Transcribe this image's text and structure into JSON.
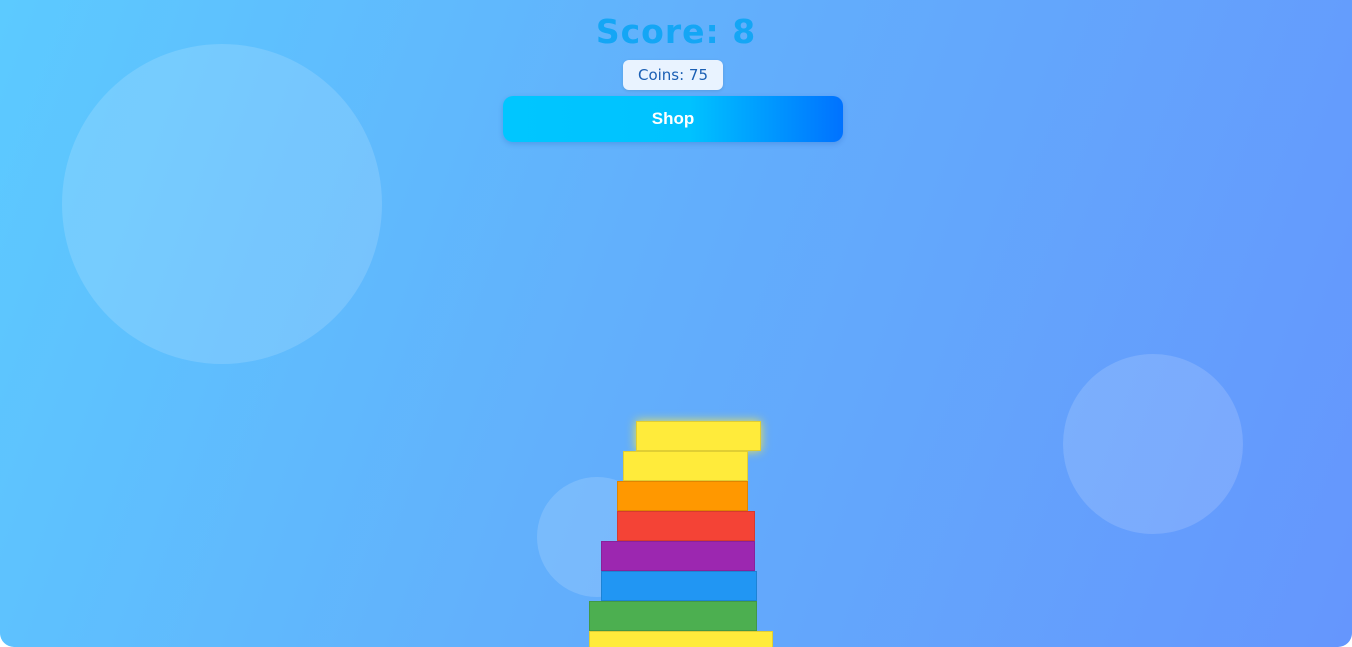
{
  "hud": {
    "score_label": "Score:",
    "score_value": "8",
    "coins_text": "Coins: 75"
  },
  "shop": {
    "label": "Shop"
  },
  "colors": {
    "score_text": "#14a6f5",
    "shop_gradient_start": "#00c6ff",
    "shop_gradient_end": "#0072ff",
    "yellow": "#ffeb3b",
    "orange": "#ff9800",
    "red": "#f44336",
    "purple": "#9c27b0",
    "blue": "#2196f3",
    "green": "#4caf50"
  },
  "tower": {
    "blocks_from_top": [
      "yellow",
      "yellow",
      "orange",
      "red",
      "purple",
      "blue",
      "green",
      "yellow"
    ]
  }
}
